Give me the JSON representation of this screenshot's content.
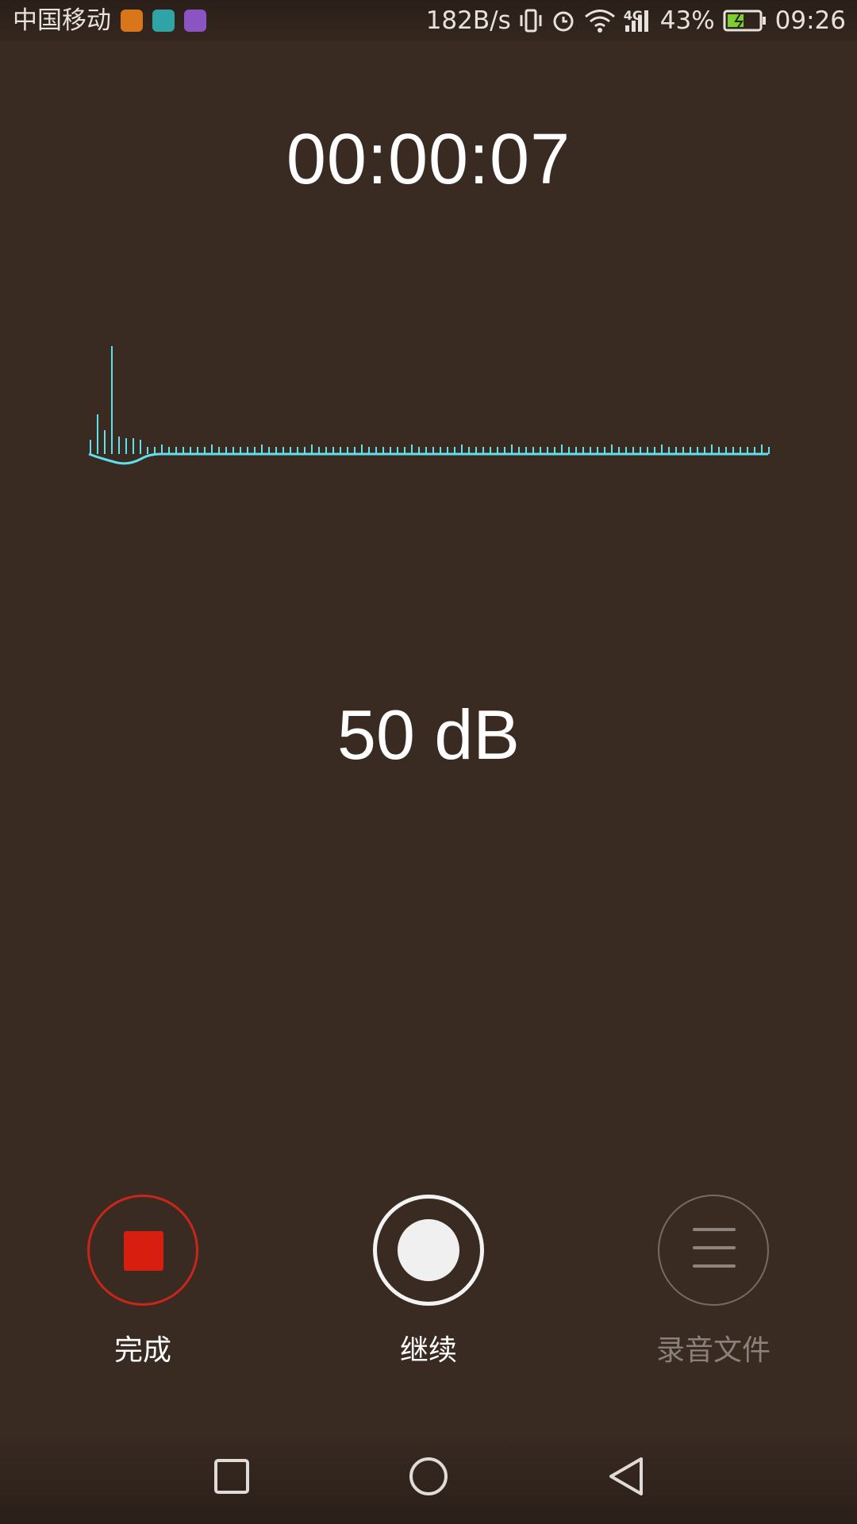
{
  "status_bar": {
    "carrier": "中国移动",
    "net_speed": "182B/s",
    "network_type": "4G",
    "battery": "43%",
    "time": "09:26",
    "icons": [
      "health-app-icon",
      "android-debug-icon",
      "gallery-icon",
      "vibrate-icon",
      "alarm-icon",
      "wifi-icon",
      "signal-icon",
      "battery-charging-icon"
    ]
  },
  "recorder": {
    "elapsed": "00:00:07",
    "level": "50 dB"
  },
  "controls": {
    "done_label": "完成",
    "resume_label": "继续",
    "files_label": "录音文件"
  },
  "colors": {
    "background": "#3a2b22",
    "waveform": "#5fe0ea",
    "stop_red": "#d81e0e"
  },
  "navigation": {
    "buttons": [
      "recent-apps",
      "home",
      "back"
    ]
  }
}
